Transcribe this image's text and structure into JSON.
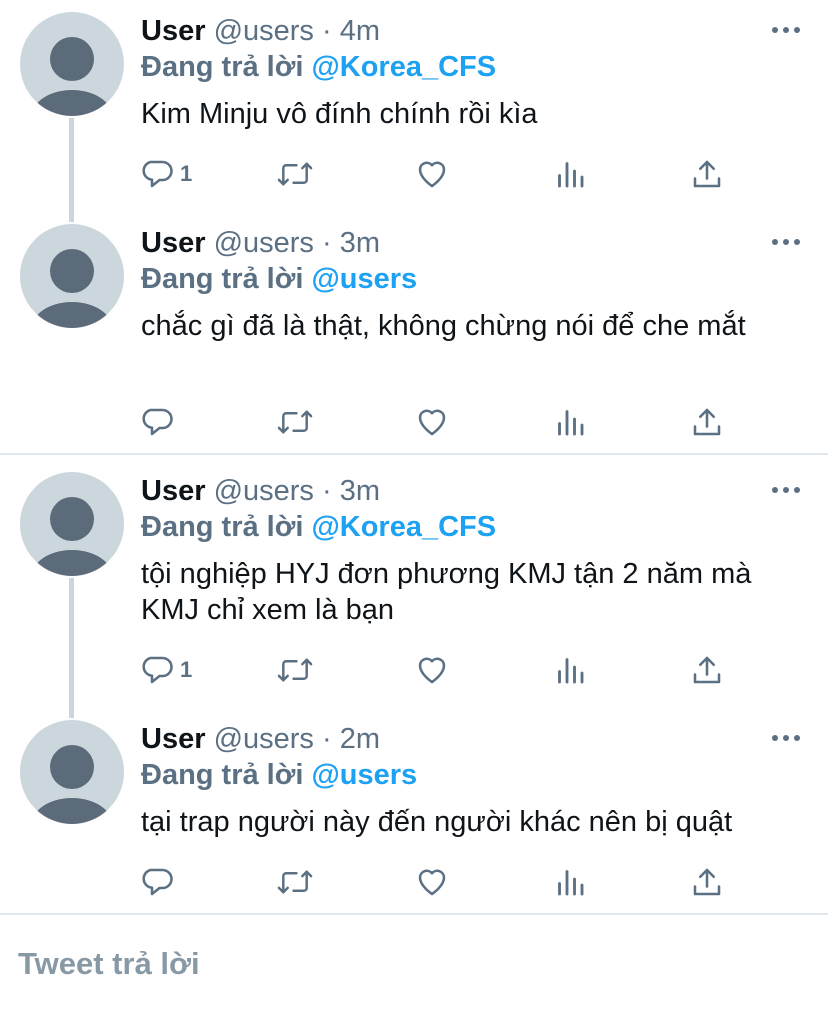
{
  "icons": {
    "reply": "reply-icon",
    "retweet": "retweet-icon",
    "like": "heart-icon",
    "analytics": "analytics-icon",
    "share": "share-icon",
    "more": "more-icon"
  },
  "colors": {
    "text": "#0f1419",
    "muted": "#5b7083",
    "link": "#1da1f2",
    "avatar_bg": "#ccd6dd",
    "avatar_fg": "#5b6b79",
    "divider": "#e1e8ed"
  },
  "tweets": [
    {
      "name": "User",
      "handle": "@users",
      "dot": "·",
      "time": "4m",
      "reply_label": "Đang trả lời",
      "reply_to": "@Korea_CFS",
      "text": "Kim Minju vô đính chính rồi kìa",
      "reply_count": "1"
    },
    {
      "name": "User",
      "handle": "@users",
      "dot": "·",
      "time": "3m",
      "reply_label": "Đang trả lời",
      "reply_to": "@users",
      "text": "chắc gì đã là thật, không chừng nói để che mắt",
      "reply_count": ""
    },
    {
      "name": "User",
      "handle": "@users",
      "dot": "·",
      "time": "3m",
      "reply_label": "Đang trả lời",
      "reply_to": "@Korea_CFS",
      "text": "tội nghiệp HYJ đơn phương KMJ tận 2 năm mà KMJ chỉ xem là bạn",
      "reply_count": "1"
    },
    {
      "name": "User",
      "handle": "@users",
      "dot": "·",
      "time": "2m",
      "reply_label": "Đang trả lời",
      "reply_to": "@users",
      "text": "tại trap người này đến người khác nên bị quật",
      "reply_count": ""
    }
  ],
  "composer": {
    "placeholder": "Tweet trả lời"
  }
}
